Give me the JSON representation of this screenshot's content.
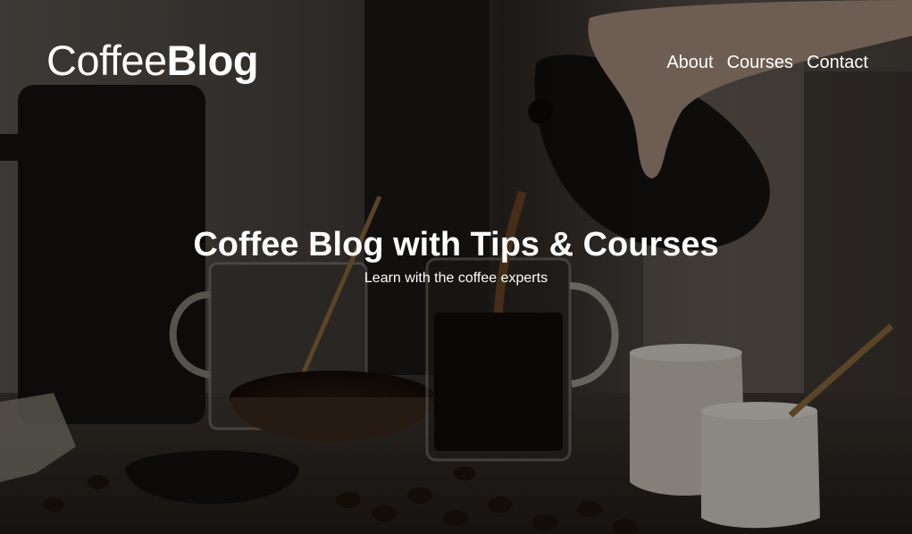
{
  "header": {
    "logo_light": "Coffee",
    "logo_bold": "Blog"
  },
  "nav": {
    "items": [
      {
        "label": "About"
      },
      {
        "label": "Courses"
      },
      {
        "label": "Contact"
      }
    ]
  },
  "hero": {
    "title": "Coffee Blog with Tips & Courses",
    "subtitle": "Learn with the coffee experts"
  },
  "colors": {
    "text": "#ffffff",
    "background": "#1b1714"
  },
  "icons": [
    "coffee-hero-image"
  ]
}
